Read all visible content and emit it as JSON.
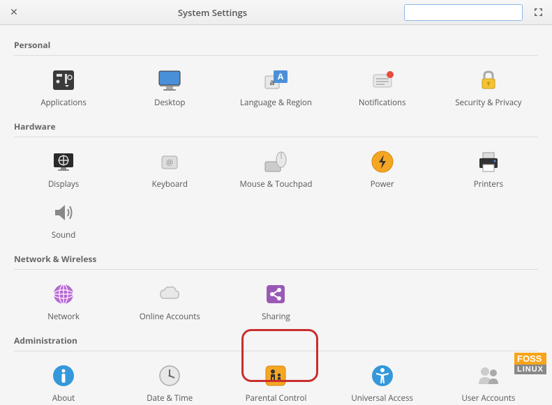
{
  "header": {
    "title": "System Settings",
    "search_placeholder": ""
  },
  "sections": {
    "personal": {
      "title": "Personal"
    },
    "hardware": {
      "title": "Hardware"
    },
    "network": {
      "title": "Network & Wireless"
    },
    "admin": {
      "title": "Administration"
    }
  },
  "items": {
    "applications": "Applications",
    "desktop": "Desktop",
    "language": "Language & Region",
    "notifications": "Notifications",
    "security": "Security & Privacy",
    "displays": "Displays",
    "keyboard": "Keyboard",
    "mouse": "Mouse & Touchpad",
    "power": "Power",
    "printers": "Printers",
    "sound": "Sound",
    "network": "Network",
    "online_accounts": "Online Accounts",
    "sharing": "Sharing",
    "about": "About",
    "datetime": "Date & Time",
    "parental": "Parental Control",
    "universal": "Universal Access",
    "users": "User Accounts"
  },
  "watermark": {
    "top": "FOSS",
    "bottom": "LINUX"
  }
}
